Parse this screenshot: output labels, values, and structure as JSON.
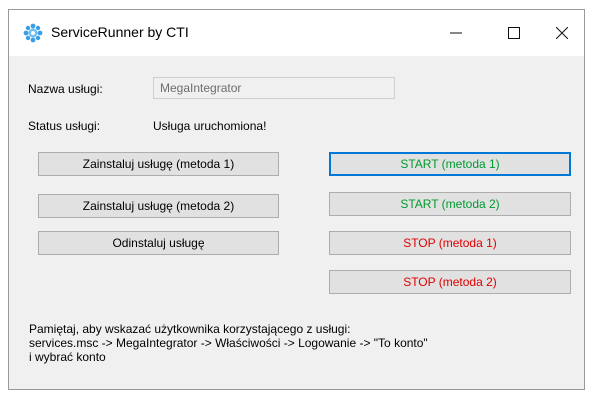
{
  "window": {
    "title": "ServiceRunner by CTI",
    "icon": "gear-snowflake-icon",
    "controls": {
      "minimize": "minimize-icon",
      "maximize": "maximize-icon",
      "close": "close-icon"
    }
  },
  "service_name": {
    "label": "Nazwa usługi:",
    "value": "MegaIntegrator"
  },
  "service_status": {
    "label": "Status usługi:",
    "value": "Usługa uruchomiona!"
  },
  "buttons": {
    "install_1": "Zainstaluj usługę (metoda 1)",
    "install_2": "Zainstaluj usługę (metoda 2)",
    "uninstall": "Odinstaluj usługę",
    "start_1": "START (metoda 1)",
    "start_2": "START (metoda 2)",
    "stop_1": "STOP (metoda 1)",
    "stop_2": "STOP (metoda 2)"
  },
  "note": {
    "line1": "Pamiętaj, aby wskazać użytkownika korzystającego z usługi:",
    "line2": "services.msc -> MegaIntegrator -> Właściwości -> Logowanie -> \"To konto\"",
    "line3": "i wybrać konto"
  },
  "colors": {
    "start": "#009a2e",
    "stop": "#e00000",
    "focus": "#0078d7"
  }
}
